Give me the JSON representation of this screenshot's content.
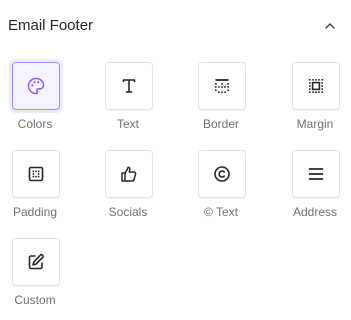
{
  "section": {
    "title": "Email Footer",
    "collapse_icon": "chevron-up-icon",
    "accent_color": "#8b5cf6"
  },
  "items": [
    {
      "label": "Colors",
      "icon": "palette-icon",
      "selected": true
    },
    {
      "label": "Text",
      "icon": "text-t-icon",
      "selected": false
    },
    {
      "label": "Border",
      "icon": "border-icon",
      "selected": false
    },
    {
      "label": "Margin",
      "icon": "margin-icon",
      "selected": false
    },
    {
      "label": "Padding",
      "icon": "padding-icon",
      "selected": false
    },
    {
      "label": "Socials",
      "icon": "thumbs-up-icon",
      "selected": false
    },
    {
      "label": "© Text",
      "icon": "copyright-icon",
      "selected": false
    },
    {
      "label": "Address",
      "icon": "menu-lines-icon",
      "selected": false
    },
    {
      "label": "Custom",
      "icon": "edit-square-icon",
      "selected": false
    }
  ]
}
